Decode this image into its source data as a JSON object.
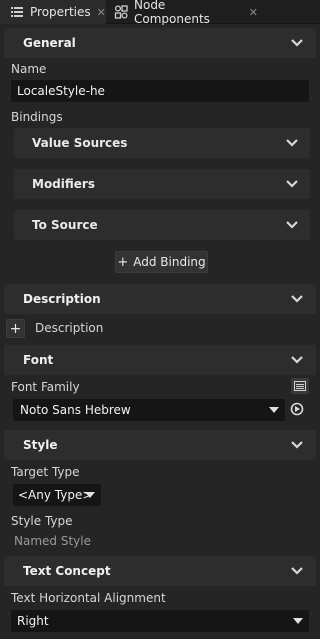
{
  "tabs": [
    {
      "label": "Properties",
      "icon": "list-icon",
      "close": "✕"
    },
    {
      "label": "Node Components",
      "icon": "node-components-icon",
      "close": "✕"
    }
  ],
  "sections": {
    "general": {
      "title": "General"
    },
    "description": {
      "title": "Description"
    },
    "font": {
      "title": "Font"
    },
    "style": {
      "title": "Style"
    },
    "text_concept": {
      "title": "Text Concept"
    }
  },
  "general": {
    "name_label": "Name",
    "name_value": "LocaleStyle-he",
    "bindings_label": "Bindings",
    "binding_groups": [
      "Value Sources",
      "Modifiers",
      "To Source"
    ],
    "add_binding_label": "Add Binding"
  },
  "description": {
    "add_label": "Description"
  },
  "font": {
    "family_label": "Font Family",
    "family_value": "Noto Sans Hebrew"
  },
  "style": {
    "target_type_label": "Target Type",
    "target_type_value": "<Any Type>",
    "style_type_label": "Style Type",
    "style_type_value": "Named Style"
  },
  "text_concept": {
    "halign_label": "Text Horizontal Alignment",
    "halign_value": "Right"
  },
  "colors": {
    "background": "#252525",
    "header": "#2d2d2d",
    "field": "#151515",
    "text": "#d4d4d4"
  }
}
